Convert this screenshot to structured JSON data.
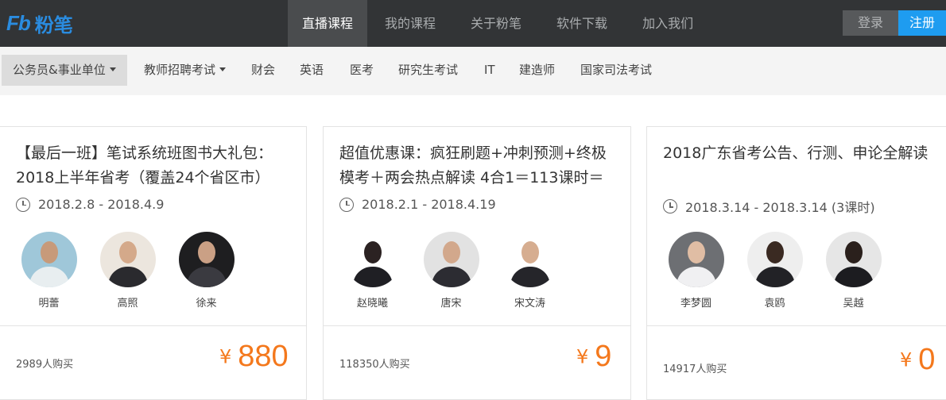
{
  "brand": {
    "mark": "Fb",
    "name": "粉笔"
  },
  "nav": {
    "items": [
      {
        "label": "直播课程",
        "active": true
      },
      {
        "label": "我的课程",
        "active": false
      },
      {
        "label": "关于粉笔",
        "active": false
      },
      {
        "label": "软件下载",
        "active": false
      },
      {
        "label": "加入我们",
        "active": false
      }
    ],
    "login_label": "登录",
    "register_label": "注册"
  },
  "categories": [
    {
      "label": "公务员&事业单位",
      "dropdown": true,
      "active": true
    },
    {
      "label": "教师招聘考试",
      "dropdown": true,
      "active": false
    },
    {
      "label": "财会",
      "dropdown": false,
      "active": false
    },
    {
      "label": "英语",
      "dropdown": false,
      "active": false
    },
    {
      "label": "医考",
      "dropdown": false,
      "active": false
    },
    {
      "label": "研究生考试",
      "dropdown": false,
      "active": false
    },
    {
      "label": "IT",
      "dropdown": false,
      "active": false
    },
    {
      "label": "建造师",
      "dropdown": false,
      "active": false
    },
    {
      "label": "国家司法考试",
      "dropdown": false,
      "active": false
    }
  ],
  "courses": [
    {
      "title": "【最后一班】笔试系统班图书大礼包：2018上半年省考（覆盖24个省区市）",
      "date": "2018.2.8 - 2018.4.9",
      "teachers": [
        {
          "name": "明蕾"
        },
        {
          "name": "高照"
        },
        {
          "name": "徐来"
        }
      ],
      "buyers": "2989人购买",
      "currency": "¥",
      "price": "880"
    },
    {
      "title": "超值优惠课：疯狂刷题+冲刺预测+终极模考＋两会热点解读 4合1＝113课时＝",
      "date": "2018.2.1 - 2018.4.19",
      "teachers": [
        {
          "name": "赵晓曦"
        },
        {
          "name": "唐宋"
        },
        {
          "name": "宋文涛"
        }
      ],
      "buyers": "118350人购买",
      "currency": "¥",
      "price": "9"
    },
    {
      "title": "2018广东省考公告、行测、申论全解读",
      "date": "2018.3.14 - 2018.3.14 (3课时)",
      "teachers": [
        {
          "name": "李梦圆"
        },
        {
          "name": "袁鸥"
        },
        {
          "name": "吴越"
        }
      ],
      "buyers": "14917人购买",
      "currency": "¥",
      "price": "0"
    }
  ],
  "colors": {
    "accent": "#1e9cf0",
    "price": "#f4781c",
    "topbar": "#323436"
  }
}
